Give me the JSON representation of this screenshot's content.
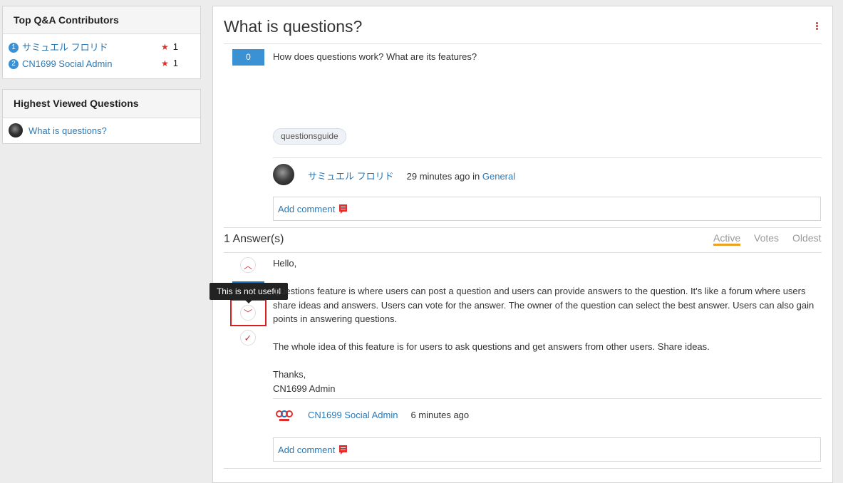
{
  "sidebar": {
    "contributors": {
      "title": "Top Q&A Contributors",
      "items": [
        {
          "rank": "1",
          "name": "サミュエル フロリド",
          "score": "1"
        },
        {
          "rank": "2",
          "name": "CN1699 Social Admin",
          "score": "1"
        }
      ]
    },
    "highest_viewed": {
      "title": "Highest Viewed Questions",
      "items": [
        {
          "title": "What is questions?"
        }
      ]
    }
  },
  "question": {
    "title": "What is questions?",
    "votes": "0",
    "body": "How does questions work? What are its features?",
    "tag": "questionsguide",
    "author": "サミュエル フロリド",
    "time": "29 minutes ago in",
    "category": "General",
    "add_comment": "Add comment"
  },
  "answers": {
    "count_label": "1 Answer(s)",
    "sort_options": [
      "Active",
      "Votes",
      "Oldest"
    ],
    "active_sort": "Active",
    "tooltip": "This is not useful",
    "items": [
      {
        "paragraphs": [
          "Hello,",
          "Questions feature is where users can post a question and users can provide answers to the question. It's like a forum where users share ideas and answers. Users can vote for the answer. The owner of the question can select the best answer. Users can also gain points in answering questions.",
          "The whole idea of this feature is for users to ask questions and get answers from other users. Share ideas.",
          "Thanks,",
          "CN1699 Admin"
        ],
        "author": "CN1699 Social Admin",
        "time": "6 minutes ago",
        "add_comment": "Add comment"
      }
    ]
  },
  "colors": {
    "accent": "#3a91d4",
    "link": "#2a7ab8",
    "danger": "#d93030",
    "active_sort": "#f0a020"
  }
}
